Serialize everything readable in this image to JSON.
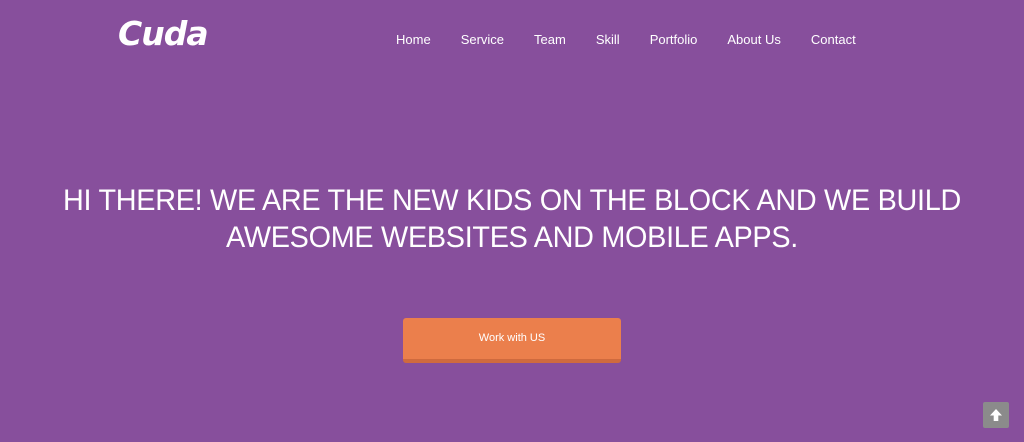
{
  "brand": {
    "logo_text": "Cuda"
  },
  "nav": {
    "items": [
      {
        "label": "Home"
      },
      {
        "label": "Service"
      },
      {
        "label": "Team"
      },
      {
        "label": "Skill"
      },
      {
        "label": "Portfolio"
      },
      {
        "label": "About Us"
      },
      {
        "label": "Contact"
      }
    ]
  },
  "hero": {
    "heading_line1": "HI THERE! WE ARE THE NEW KIDS ON THE BLOCK AND WE BUILD",
    "heading_line2": "AWESOME WEBSITES AND MOBILE APPS.",
    "cta_label": "Work with US"
  },
  "scroll_top": {
    "icon": "arrow-up-icon"
  },
  "colors": {
    "background": "#874f9c",
    "cta": "#eb7f4c",
    "cta_shadow": "#cf6a3e",
    "scroll_top_bg": "#8b8b8b",
    "text": "#ffffff"
  }
}
